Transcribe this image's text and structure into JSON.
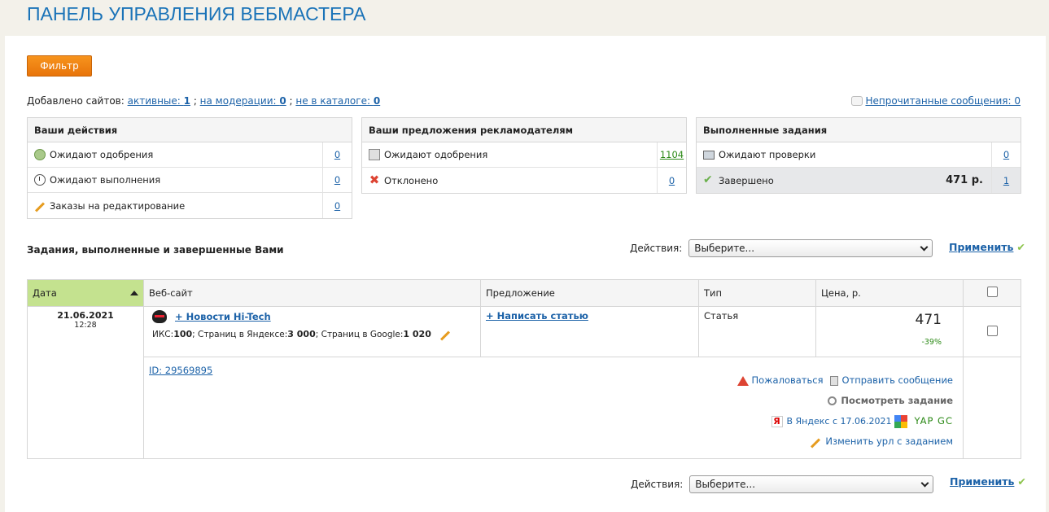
{
  "page_title": "ПАНЕЛЬ УПРАВЛЕНИЯ ВЕБМАСТЕРА",
  "filter_button": "Фильтр",
  "sites": {
    "prefix": "Добавлено сайтов: ",
    "active_label": "активные: ",
    "active_count": "1",
    "sep1": " ; ",
    "moderation_label": "на модерации: ",
    "moderation_count": "0",
    "sep2": " ; ",
    "not_in_catalog_label": "не в каталоге: ",
    "not_in_catalog_count": "0"
  },
  "unread_messages": "Непрочитанные сообщения: 0",
  "your_actions": {
    "title": "Ваши действия",
    "rows": [
      {
        "label": "Ожидают одобрения",
        "count": "0",
        "icon": "plus-circle-icon"
      },
      {
        "label": "Ожидают выполнения",
        "count": "0",
        "icon": "clock-icon"
      },
      {
        "label": "Заказы на редактирование",
        "count": "0",
        "icon": "pencil-icon"
      }
    ]
  },
  "offers": {
    "title": "Ваши предложения рекламодателям",
    "rows": [
      {
        "label": "Ожидают одобрения",
        "count": "1104",
        "icon": "document-icon"
      },
      {
        "label": "Отклонено",
        "count": "0",
        "icon": "x-icon"
      }
    ]
  },
  "completed": {
    "title": "Выполненные задания",
    "rows": [
      {
        "label": "Ожидают проверки",
        "count": "0",
        "icon": "monitor-icon"
      },
      {
        "label": "Завершено",
        "sum": "471 р.",
        "count": "1",
        "icon": "check-icon"
      }
    ]
  },
  "section_title": "Задания, выполненные и завершенные Вами",
  "actions_label": "Действия:",
  "select_value": "Выберите...",
  "apply_label": "Применить",
  "table": {
    "headers": {
      "date": "Дата",
      "site": "Веб-сайт",
      "offer": "Предложение",
      "type": "Тип",
      "price": "Цена, р."
    },
    "row": {
      "date": "21.06.2021",
      "time": "12:28",
      "site_name": "+ Новости Hi-Tech",
      "iks_label": "ИКС: ",
      "iks_value": "100",
      "yandex_pages_label": "; Страниц в Яндексе: ",
      "yandex_pages_value": "3 000",
      "google_pages_label": "; Страниц в Google: ",
      "google_pages_value": "1 020",
      "offer": "+ Написать статью",
      "type": "Статья",
      "price": "471",
      "discount": "-39%"
    },
    "details": {
      "id": "ID: 29569895",
      "complain": "Пожаловаться",
      "send_message": "Отправить сообщение",
      "view_task": "Посмотреть задание",
      "yandex_since": "В Яндекс с 17.06.2021",
      "yap_gc": "YAP GC",
      "change_url": "Изменить урл с заданием"
    }
  }
}
